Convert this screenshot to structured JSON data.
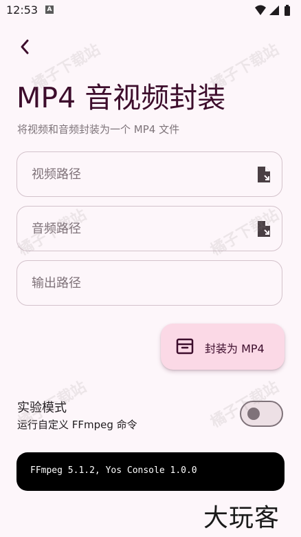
{
  "status_bar": {
    "time": "12:53",
    "notification_letter": "A",
    "icons": [
      "wifi-icon",
      "signal-icon",
      "battery-icon"
    ]
  },
  "header": {
    "back_icon": "chevron-left-icon",
    "title": "MP4 音视频封装",
    "subtitle": "将视频和音频封装为一个 MP4 文件"
  },
  "form": {
    "video_path": {
      "placeholder": "视频路径",
      "value": "",
      "icon": "file-select-icon"
    },
    "audio_path": {
      "placeholder": "音频路径",
      "value": "",
      "icon": "file-select-icon"
    },
    "output_path": {
      "placeholder": "输出路径",
      "value": ""
    }
  },
  "action": {
    "label": "封装为 MP4",
    "icon": "archive-icon"
  },
  "experiment": {
    "title": "实验模式",
    "description": "运行自定义 FFmpeg 命令",
    "enabled": false
  },
  "console": {
    "text": "FFmpeg 5.1.2, Yos Console 1.0.0"
  },
  "watermarks": {
    "site": "橘子下载站",
    "brand": "大玩客"
  },
  "colors": {
    "background": "#fdf6fa",
    "title": "#3d0d2c",
    "fab_background": "#fbd9e6",
    "outline": "#d3c2cb",
    "console_background": "#000000"
  }
}
